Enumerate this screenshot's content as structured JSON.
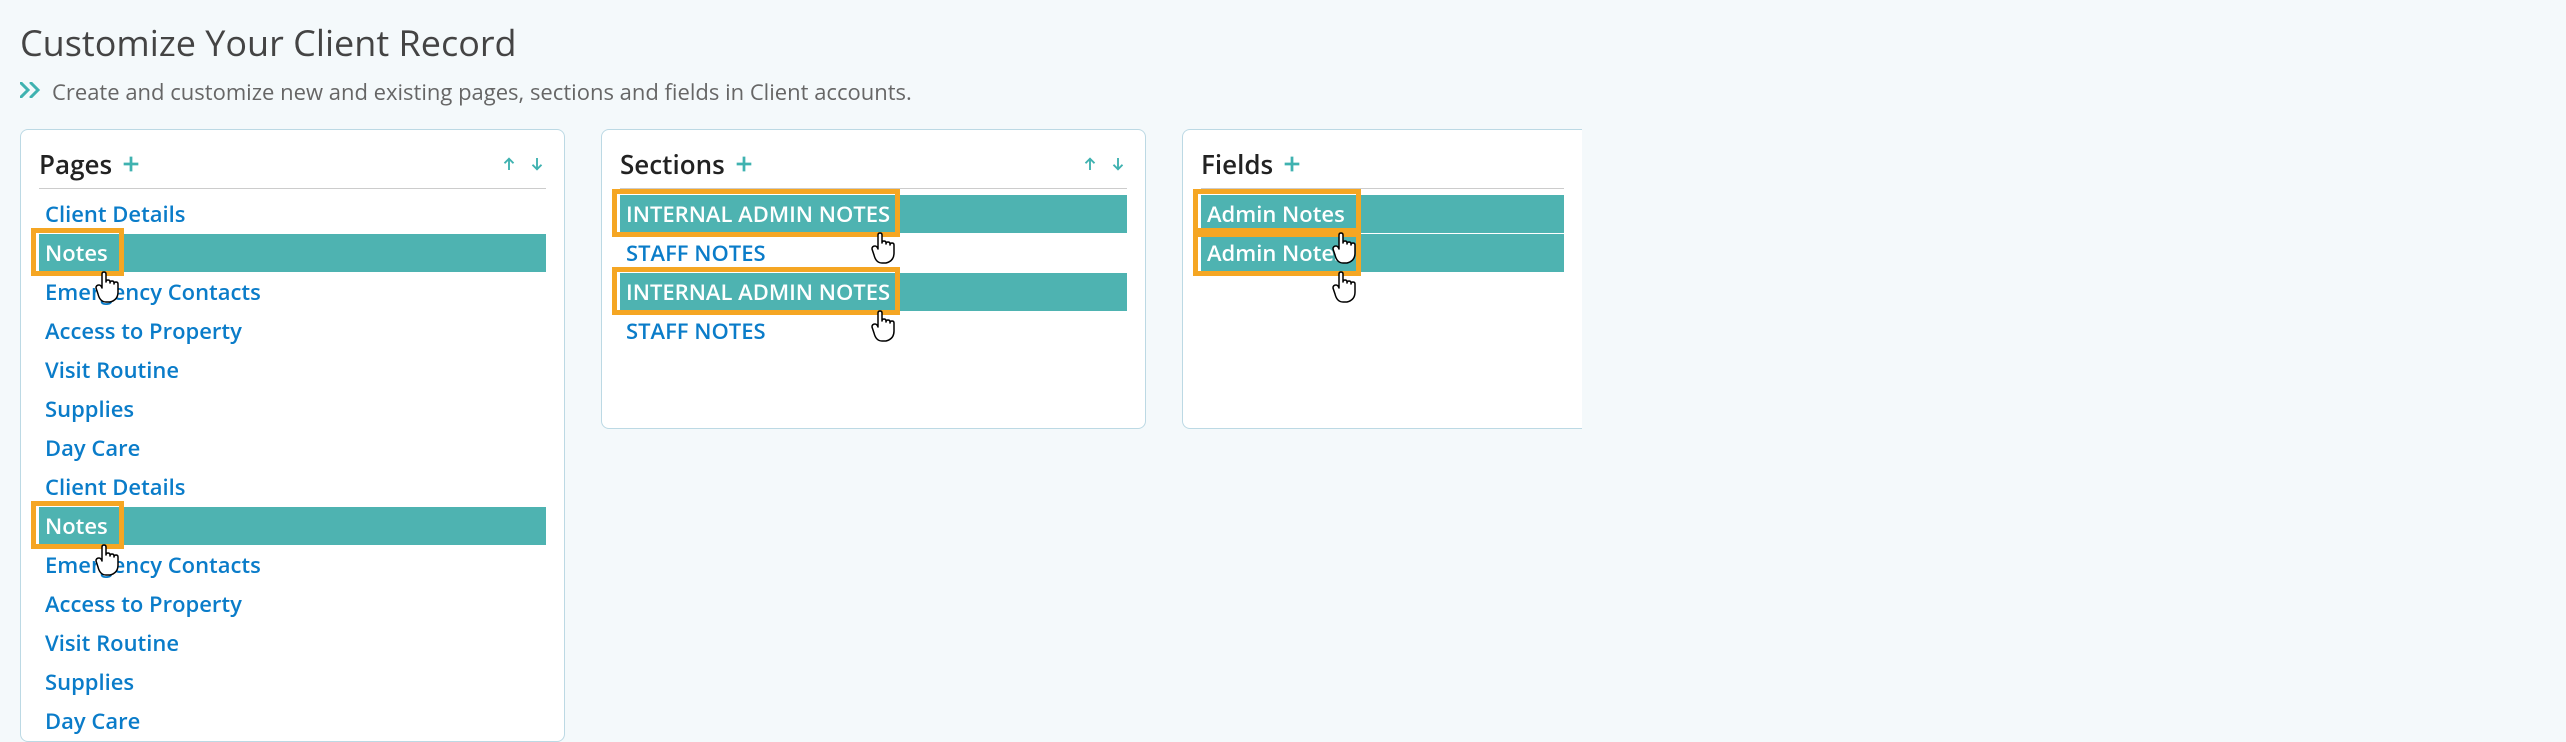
{
  "header": {
    "title": "Customize Your Client Record",
    "hint": "Create and customize new and existing pages, sections and fields in Client accounts."
  },
  "panels": {
    "pages": {
      "title": "Pages",
      "items": [
        {
          "label": "Client Details",
          "selected": false
        },
        {
          "label": "Notes",
          "selected": true,
          "highlighted": true,
          "cursor": true
        },
        {
          "label": "Emergency Contacts",
          "selected": false
        },
        {
          "label": "Access to Property",
          "selected": false
        },
        {
          "label": "Visit Routine",
          "selected": false
        },
        {
          "label": "Supplies",
          "selected": false
        },
        {
          "label": "Day Care",
          "selected": false
        }
      ]
    },
    "sections": {
      "title": "Sections",
      "items": [
        {
          "label": "INTERNAL ADMIN NOTES",
          "selected": true,
          "highlighted": true,
          "cursor": true
        },
        {
          "label": "STAFF NOTES",
          "selected": false
        }
      ]
    },
    "fields": {
      "title": "Fields",
      "items": [
        {
          "label": "Admin Notes",
          "selected": true,
          "highlighted": true,
          "cursor": true
        }
      ]
    }
  }
}
